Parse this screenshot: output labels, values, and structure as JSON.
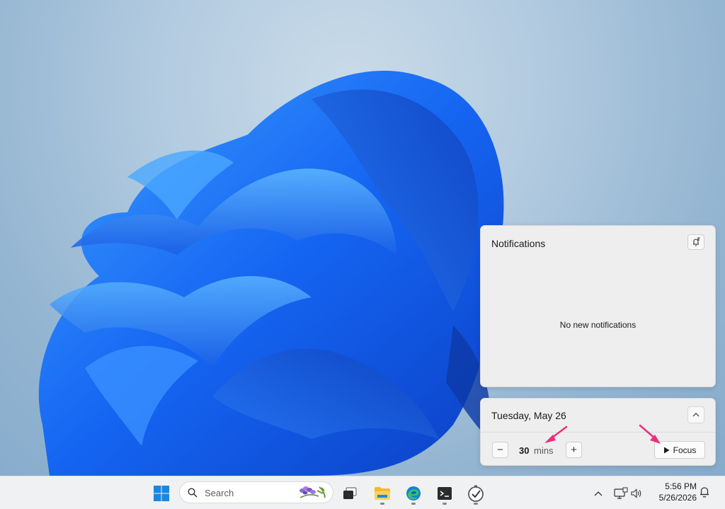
{
  "notifications": {
    "title": "Notifications",
    "empty_message": "No new notifications",
    "dnd_icon": "bell-snooze-icon"
  },
  "calendar": {
    "date_label": "Tuesday, May 26",
    "collapse_icon": "chevron-up-icon"
  },
  "focus": {
    "duration_value": "30",
    "duration_unit": "mins",
    "decrease_label": "−",
    "increase_label": "+",
    "start_label": "Focus",
    "start_icon": "play-icon"
  },
  "annotations": {
    "arrow_color": "#e8317a"
  },
  "taskbar": {
    "search_placeholder": "Search",
    "apps": [
      {
        "name": "start",
        "icon": "windows-logo-icon"
      },
      {
        "name": "task-view",
        "icon": "task-view-icon"
      },
      {
        "name": "file-explorer",
        "icon": "folder-icon",
        "running": true
      },
      {
        "name": "edge",
        "icon": "edge-browser-icon",
        "running": true
      },
      {
        "name": "terminal",
        "icon": "terminal-icon",
        "running": true
      },
      {
        "name": "clock-app",
        "icon": "clock-check-icon",
        "running": true
      }
    ],
    "tray": {
      "chevron_icon": "chevron-up-icon",
      "network_icon": "network-icon",
      "volume_icon": "speaker-icon"
    },
    "time": "5:56 PM",
    "date": "5/26/2026",
    "notification_icon": "bell-icon"
  },
  "colors": {
    "accent": "#0078d4",
    "wallpaper_blue": "#1e6cf0"
  }
}
